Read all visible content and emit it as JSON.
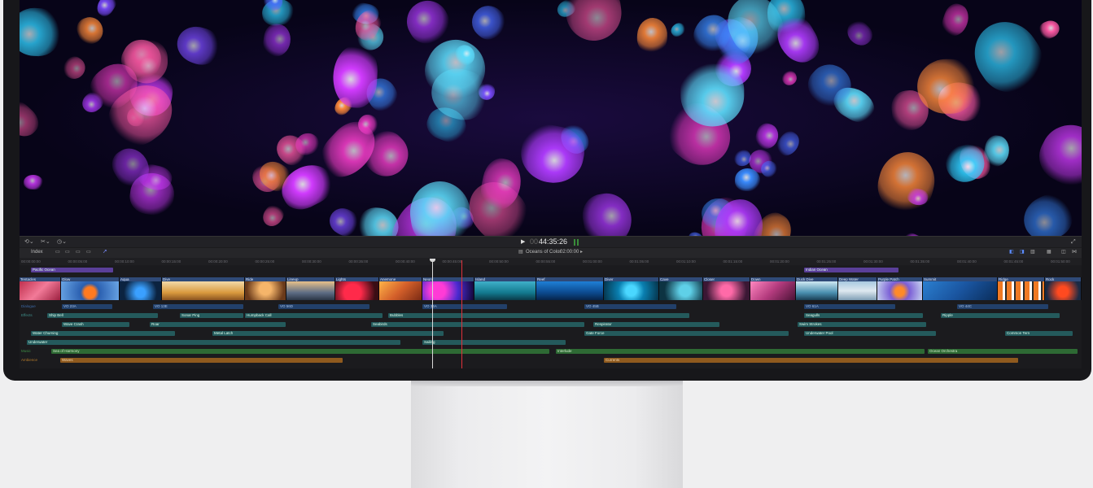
{
  "viewer": {
    "timecode_prefix": "00",
    "timecode": "44:35:26",
    "project_title": "Oceans of Color",
    "project_duration": "02:00:00"
  },
  "toolbar": {
    "index_label": "Index"
  },
  "ruler": {
    "ticks": [
      "00:00:00:00",
      "00:00:05:00",
      "00:00:10:00",
      "00:00:15:00",
      "00:00:20:00",
      "00:00:25:00",
      "00:00:30:00",
      "00:00:35:00",
      "00:00:40:00",
      "00:00:45:00",
      "00:00:50:00",
      "00:00:55:00",
      "00:01:00:00",
      "00:01:05:00",
      "00:01:10:00",
      "00:01:15:00",
      "00:01:20:00",
      "00:01:25:00",
      "00:01:30:00",
      "00:01:35:00",
      "00:01:40:00",
      "00:01:45:00",
      "00:01:50:00"
    ]
  },
  "roles": {
    "dialogue": "Dialogue",
    "effects": "Effects",
    "music": "Music",
    "ambience": "Ambience"
  },
  "titles": [
    "Pacific Ocean",
    "Indian Ocean"
  ],
  "video_clips": [
    "Tentacles",
    "Glow",
    "Aqua",
    "Dive",
    "Ride",
    "Lineup",
    "Lights",
    "Anemone",
    "Neon",
    "Island",
    "Reef",
    "Diver",
    "Cave",
    "Closer",
    "Down",
    "Duck Dive",
    "Deep Water",
    "Purple Patch",
    "Summit",
    "Ridge",
    "Rock"
  ],
  "dialogue_clips": [
    "VO 23A",
    "VO 13E",
    "VO 56D",
    "VO 34A",
    "VO 45B",
    "VO 61A",
    "VO 44C"
  ],
  "effects_row1": [
    "Ship Bell",
    "Sonar Ping",
    "Humpback Call",
    "Bubbles",
    "Seagulls",
    "Ripple"
  ],
  "effects_row2": [
    "Wave Crash",
    "Roar",
    "Seabirds",
    "Respirator",
    "Swim Strokes"
  ],
  "effects_row3": [
    "Water Churning",
    "Metal Latch",
    "Gate Force",
    "Underwater Pool",
    "Common Tern"
  ],
  "effects_row4": [
    "Underwater",
    "Sailing"
  ],
  "music_clips": [
    "Sea of Harmony",
    "Interlude",
    "Ocean Orchestra"
  ],
  "ambience_clips": [
    "Waves",
    "Currents"
  ]
}
